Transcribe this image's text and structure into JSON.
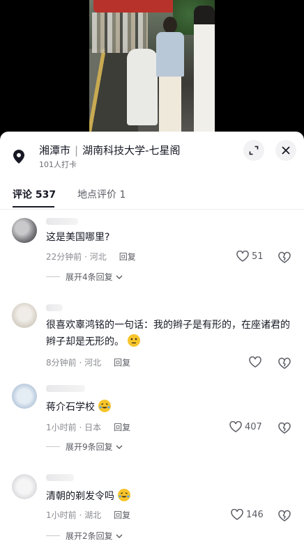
{
  "location": {
    "city": "湘潭市",
    "place": "湖南科技大学-七星阁",
    "checkins": "101人打卡",
    "icons": [
      "location-pin-icon",
      "expand-icon",
      "close-icon"
    ]
  },
  "tabs": [
    {
      "label": "评论 537"
    },
    {
      "label": "地点评价 1"
    }
  ],
  "comments": [
    {
      "text": "这是美国哪里?",
      "meta": "22分钟前 · 河北",
      "reply": "回复",
      "likes": "51",
      "expand": "展开4条回复"
    },
    {
      "text": "很喜欢辜鸿铭的一句话：我的辫子是有形的，在座诸君的辫子却是无形的。",
      "meta": "8分钟前 · 河北",
      "reply": "回复",
      "likes": ""
    },
    {
      "text": "蒋介石学校",
      "meta": "1小时前 · 日本",
      "reply": "回复",
      "likes": "407",
      "expand": "展开9条回复"
    },
    {
      "text": "清朝的剃发令吗",
      "meta": "1小时前 · 湖北",
      "reply": "回复",
      "likes": "146",
      "expand": "展开2条回复"
    }
  ],
  "colors": {
    "text": "#161823",
    "secondary": "#8a8b91",
    "emoji": "#f7c52b"
  }
}
